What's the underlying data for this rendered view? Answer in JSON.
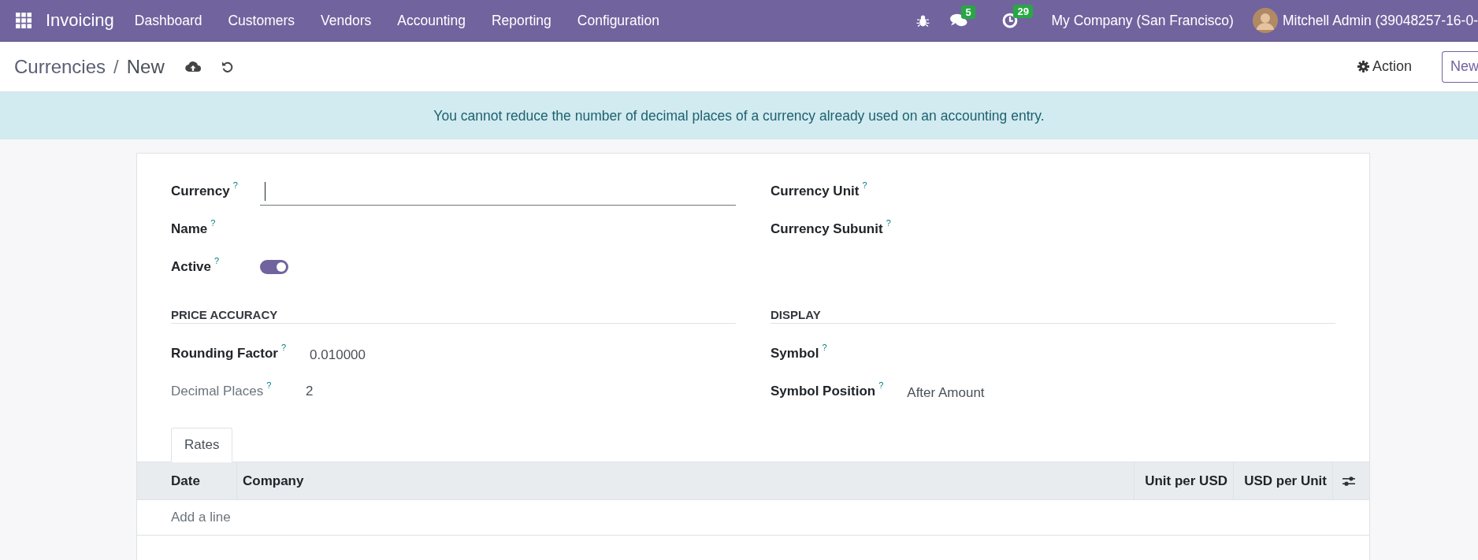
{
  "navbar": {
    "app_name": "Invoicing",
    "menu": [
      "Dashboard",
      "Customers",
      "Vendors",
      "Accounting",
      "Reporting",
      "Configuration"
    ],
    "chat_badge": "5",
    "activity_badge": "29",
    "company": "My Company (San Francisco)",
    "user": "Mitchell Admin (39048257-16-0-"
  },
  "control_panel": {
    "breadcrumb": [
      "Currencies",
      "New"
    ],
    "separator": "/",
    "action": "Action",
    "new_button": "New"
  },
  "alert": "You cannot reduce the number of decimal places of a currency already used on an accounting entry.",
  "form": {
    "columns": [
      {
        "fields": [
          {
            "kind": "input",
            "label": "Currency",
            "help": "?"
          },
          {
            "kind": "text",
            "label": "Name",
            "help": "?"
          },
          {
            "kind": "toggle",
            "label": "Active",
            "help": "?",
            "on": true
          }
        ]
      },
      {
        "fields": [
          {
            "kind": "text",
            "label": "Currency Unit",
            "help": "?"
          },
          {
            "kind": "text",
            "label": "Currency Subunit",
            "help": "?"
          }
        ]
      }
    ],
    "sections": [
      {
        "title": "PRICE ACCURACY",
        "fields": [
          {
            "label": "Rounding Factor",
            "help": "?",
            "value": "0.010000",
            "readonly": false
          },
          {
            "label": "Decimal Places",
            "help": "?",
            "value": "2",
            "readonly": true
          }
        ]
      },
      {
        "title": "DISPLAY",
        "fields": [
          {
            "label": "Symbol",
            "help": "?",
            "readonly": false
          },
          {
            "label": "Symbol Position",
            "help": "?",
            "value": "After Amount",
            "readonly": false
          }
        ]
      }
    ],
    "tabs": [
      {
        "label": "Rates",
        "selected": true
      }
    ],
    "table": {
      "columns": [
        "Date",
        "Company",
        "Unit per USD",
        "USD per Unit"
      ],
      "add_line": "Add a line"
    }
  }
}
